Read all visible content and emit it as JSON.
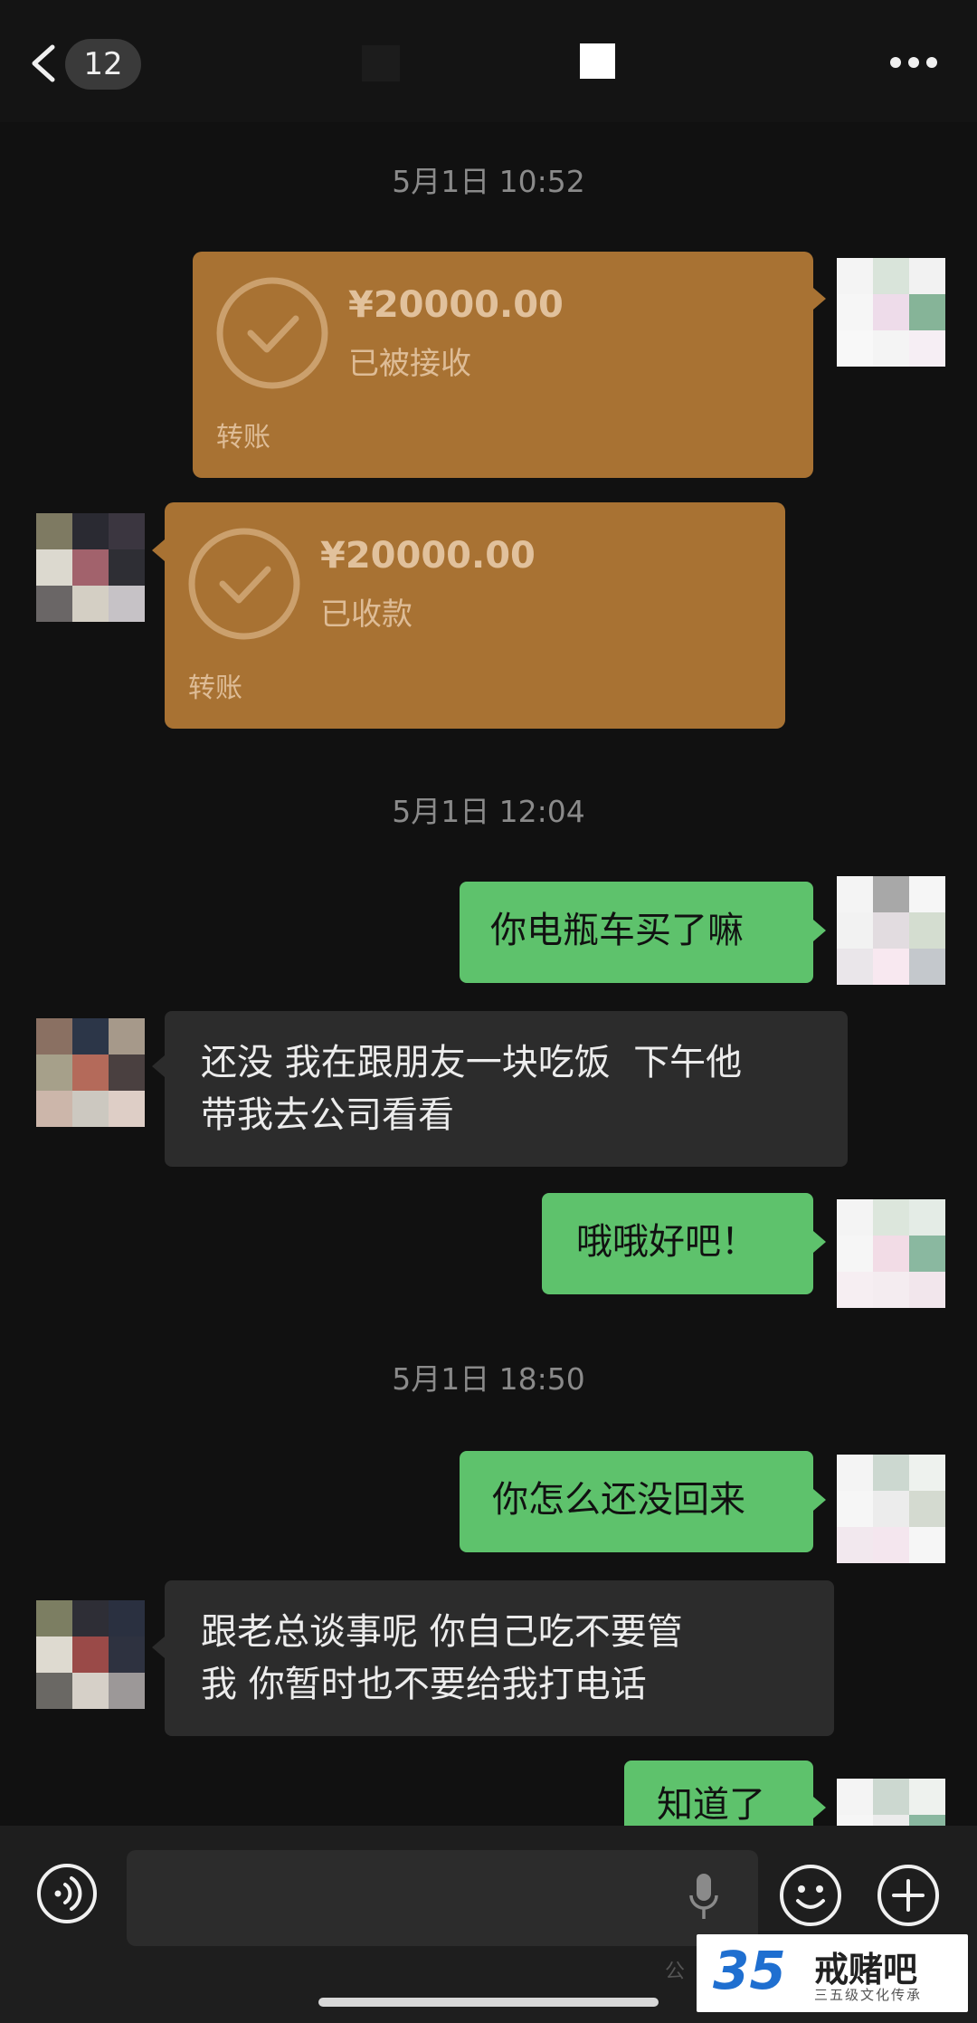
{
  "header": {
    "unread_count": "12"
  },
  "messages": {
    "time1": "5月1日 10:52",
    "transfer_sent": {
      "amount": "¥20000.00",
      "status": "已被接收",
      "label": "转账"
    },
    "transfer_received": {
      "amount": "¥20000.00",
      "status": "已收款",
      "label": "转账"
    },
    "time2": "5月1日 12:04",
    "msg1": "你电瓶车买了嘛",
    "msg2_line1": "还没 我在跟朋友一块吃饭  下午他",
    "msg2_line2": "带我去公司看看",
    "msg3": "哦哦好吧！",
    "time3": "5月1日 18:50",
    "msg4": "你怎么还没回来",
    "msg5_line1": "跟老总谈事呢 你自己吃不要管",
    "msg5_line2": "我 你暂时也不要给我打电话",
    "msg6": "知道了"
  },
  "input": {
    "placeholder": ""
  },
  "watermark": {
    "number": "35",
    "title": "戒赌吧",
    "subtitle": "三五级文化传承",
    "left_text": "公"
  },
  "colors": {
    "green_bubble": "#5ec26c",
    "transfer_orange": "#a87233",
    "background": "#111111"
  }
}
